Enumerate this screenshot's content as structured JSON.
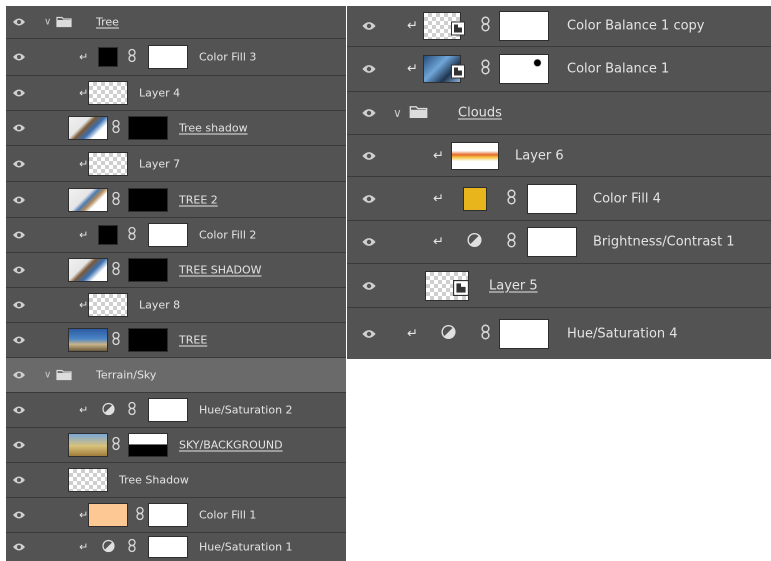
{
  "left_panel": {
    "rows": [
      {
        "label": "Tree",
        "kind": "group",
        "expanded": true
      },
      {
        "label": "Color Fill 3",
        "kind": "fill",
        "fill_color": "#000000",
        "clipped": true
      },
      {
        "label": "Layer 4",
        "kind": "pixel",
        "clipped": true
      },
      {
        "label": "Tree shadow",
        "kind": "masked"
      },
      {
        "label": "Layer 7",
        "kind": "pixel",
        "clipped": true
      },
      {
        "label": "TREE 2",
        "kind": "masked"
      },
      {
        "label": "Color Fill 2",
        "kind": "fill",
        "fill_color": "#000000",
        "clipped": true
      },
      {
        "label": "TREE SHADOW",
        "kind": "masked"
      },
      {
        "label": "Layer 8",
        "kind": "pixel",
        "clipped": true
      },
      {
        "label": "TREE",
        "kind": "masked"
      },
      {
        "label": "Terrain/Sky",
        "kind": "group",
        "expanded": true,
        "selected": true
      },
      {
        "label": "Hue/Saturation 2",
        "kind": "adjustment",
        "clipped": true
      },
      {
        "label": "SKY/BACKGROUND",
        "kind": "masked"
      },
      {
        "label": "Tree Shadow",
        "kind": "pixel"
      },
      {
        "label": "Color Fill 1",
        "kind": "fill",
        "fill_color": "#fdc894",
        "clipped": true
      },
      {
        "label": "Hue/Saturation 1",
        "kind": "adjustment",
        "clipped": true
      }
    ]
  },
  "right_panel": {
    "rows": [
      {
        "label": "Color Balance 1 copy",
        "kind": "smart-masked",
        "clipped": true
      },
      {
        "label": "Color Balance 1",
        "kind": "smart-masked",
        "clipped": true
      },
      {
        "label": "Clouds",
        "kind": "group",
        "expanded": true
      },
      {
        "label": "Layer 6",
        "kind": "pixel",
        "clipped": true
      },
      {
        "label": "Color Fill 4",
        "kind": "fill",
        "fill_color": "#e8b51c",
        "clipped": true
      },
      {
        "label": "Brightness/Contrast 1",
        "kind": "adjustment",
        "clipped": true
      },
      {
        "label": "Layer 5",
        "kind": "smart"
      },
      {
        "label": "Hue/Saturation 4",
        "kind": "adjustment",
        "clipped": true
      }
    ]
  },
  "colors": {
    "panel_bg": "#535353",
    "selected_row": "#6a6a6a",
    "text": "#e4e4e4"
  },
  "icons": {
    "visibility": "eye-icon",
    "group": "folder-icon",
    "clip": "clip-arrow-icon",
    "link": "chain-link-icon",
    "adjustment": "adjustment-circle-icon",
    "smart_object": "smart-object-icon"
  }
}
